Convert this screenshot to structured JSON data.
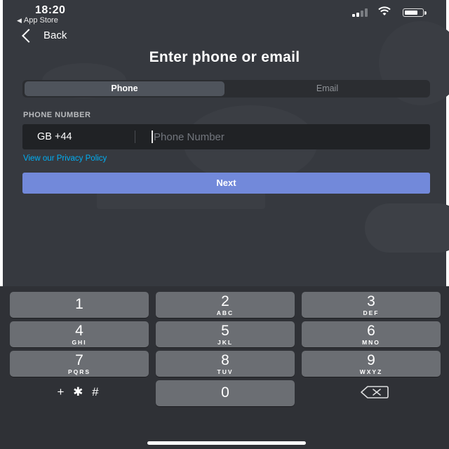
{
  "status_bar": {
    "time": "18:20",
    "back_app": "App Store"
  },
  "nav": {
    "back_label": "Back"
  },
  "title": "Enter phone or email",
  "segment": {
    "options": [
      "Phone",
      "Email"
    ],
    "selected": "Phone"
  },
  "phone": {
    "label": "PHONE NUMBER",
    "country_code": "GB +44",
    "placeholder": "Phone Number",
    "value": ""
  },
  "privacy_link": "View our Privacy Policy",
  "next_button": "Next",
  "keypad": {
    "keys": [
      {
        "num": "1",
        "letters": ""
      },
      {
        "num": "2",
        "letters": "ABC"
      },
      {
        "num": "3",
        "letters": "DEF"
      },
      {
        "num": "4",
        "letters": "GHI"
      },
      {
        "num": "5",
        "letters": "JKL"
      },
      {
        "num": "6",
        "letters": "MNO"
      },
      {
        "num": "7",
        "letters": "PQRS"
      },
      {
        "num": "8",
        "letters": "TUV"
      },
      {
        "num": "9",
        "letters": "WXYZ"
      },
      {
        "num": "0",
        "letters": ""
      }
    ],
    "symbols_key": "+ ✱ #",
    "delete_icon": "backspace-icon"
  },
  "colors": {
    "background": "#36393f",
    "accent": "#7289da",
    "link": "#00aff4",
    "input_bg": "#202225"
  }
}
